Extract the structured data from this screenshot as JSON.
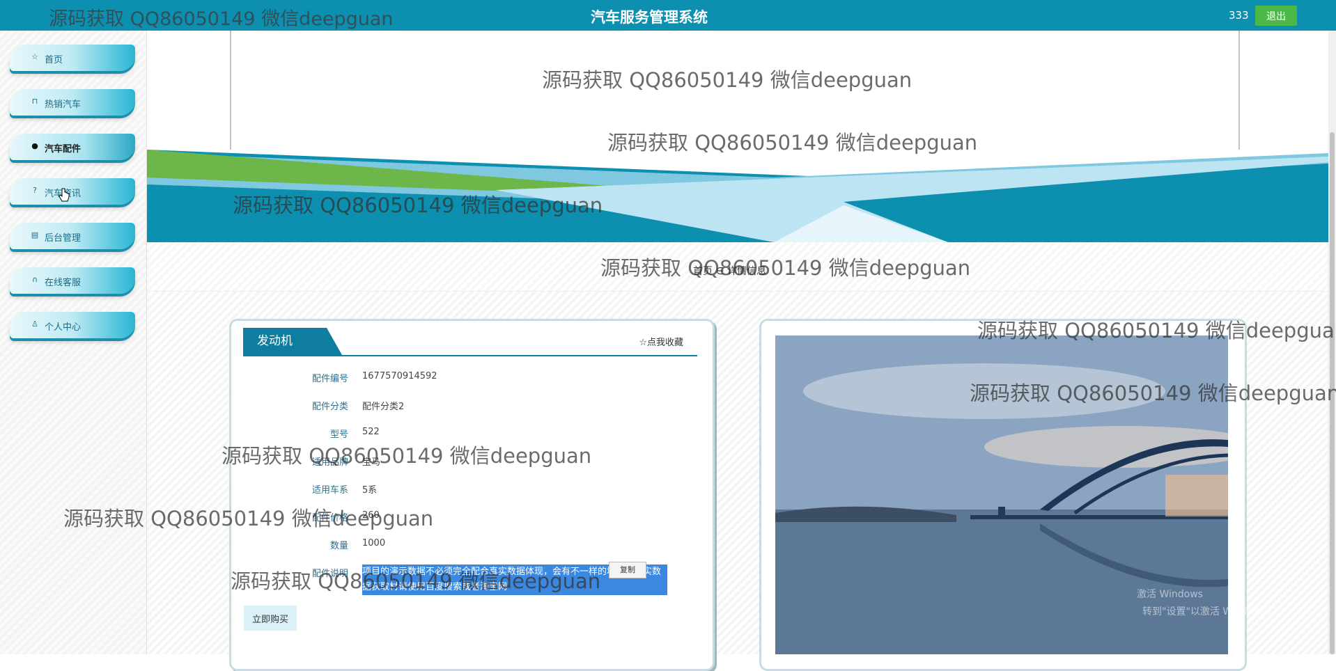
{
  "header": {
    "title": "汽车服务管理系统",
    "username": "333",
    "logout_label": "退出"
  },
  "watermark": "源码获取 QQ86050149 微信deepguan",
  "sidebar": {
    "items": [
      {
        "label": "首页",
        "icon": "home-icon"
      },
      {
        "label": "热销汽车",
        "icon": "bag-icon"
      },
      {
        "label": "汽车配件",
        "icon": "info-circle-icon"
      },
      {
        "label": "汽车资讯",
        "icon": "question-circle-icon"
      },
      {
        "label": "后台管理",
        "icon": "building-icon"
      },
      {
        "label": "在线客服",
        "icon": "headset-icon"
      },
      {
        "label": "个人中心",
        "icon": "user-icon"
      }
    ],
    "active_index": 2
  },
  "breadcrumb": {
    "home": "首页",
    "separator": "∈",
    "current": "详情信息"
  },
  "detail": {
    "title": "发动机",
    "favorite_label": "☆点我收藏",
    "fields": [
      {
        "label": "配件编号",
        "value": "1677570914592"
      },
      {
        "label": "配件分类",
        "value": "配件分类2"
      },
      {
        "label": "型号",
        "value": "522"
      },
      {
        "label": "适用品牌",
        "value": "宝马"
      },
      {
        "label": "适用车系",
        "value": "5系"
      },
      {
        "label": "配件价格",
        "value": "260"
      },
      {
        "label": "数量",
        "value": "1000"
      },
      {
        "label": "配件说明",
        "value": "项目的演示数据不必须完全配合真实数据体现，会有不一样的地方，真实数据获取材请使用百度搜索或者淘宝网"
      }
    ],
    "copy_label": "复制",
    "buy_label": "立即购买"
  },
  "windows_activation": {
    "line1": "激活 Windows",
    "line2": "转到\"设置\"以激活 Windows。"
  },
  "colors": {
    "header_bg": "#0d8fb0",
    "logout_bg": "#4cb84a",
    "accent": "#0e7da0"
  }
}
